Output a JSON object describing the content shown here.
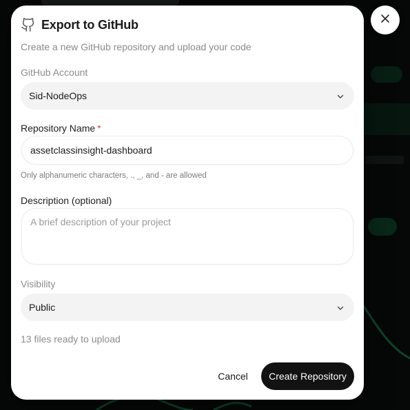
{
  "dialog": {
    "title": "Export to GitHub",
    "subtitle": "Create a new GitHub repository and upload your code",
    "github_icon": "github-icon"
  },
  "account": {
    "label": "GitHub Account",
    "value": "Sid-NodeOps"
  },
  "repo_name": {
    "label": "Repository Name",
    "required_mark": "*",
    "value": "assetclassinsight-dashboard",
    "hint": "Only alphanumeric characters, ., _, and - are allowed"
  },
  "description": {
    "label": "Description (optional)",
    "value": "",
    "placeholder": "A brief description of your project"
  },
  "visibility": {
    "label": "Visibility",
    "value": "Public"
  },
  "files_status": "13 files ready to upload",
  "actions": {
    "cancel_label": "Cancel",
    "create_label": "Create Repository"
  },
  "colors": {
    "primary_button": "#121212",
    "required": "#e0474b",
    "background_accent": "#1fd07a"
  }
}
